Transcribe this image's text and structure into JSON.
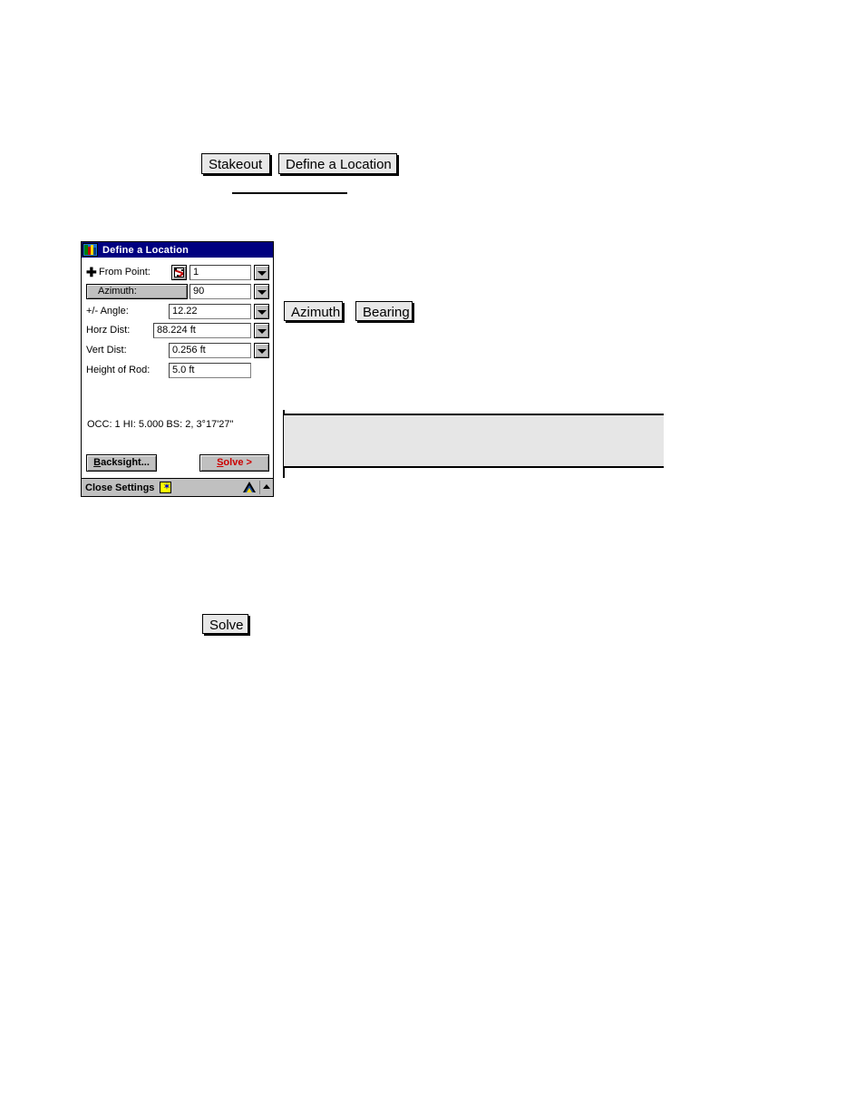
{
  "doc": {
    "buttons": {
      "stakeout": "Stakeout",
      "define_a_location": "Define a Location",
      "azimuth": "Azimuth",
      "bearing": "Bearing",
      "solve": "Solve"
    }
  },
  "pda": {
    "title": "Define a Location",
    "title_icon": "map-icon",
    "fields": [
      {
        "label": "From Point:",
        "icon": "plus-icon",
        "pick_icon": "point-pick-icon",
        "value": "1",
        "has_dropdown": true
      },
      {
        "label": "Azimuth:",
        "is_button": true,
        "value": "90",
        "has_dropdown": true
      },
      {
        "label": "+/- Angle:",
        "value": "12.22",
        "has_dropdown": true
      },
      {
        "label": "Horz Dist:",
        "value": "88.224 ft",
        "has_dropdown": true
      },
      {
        "label": "Vert Dist:",
        "value": "0.256 ft",
        "has_dropdown": true
      },
      {
        "label": "Height of Rod:",
        "value": "5.0 ft",
        "has_dropdown": false
      }
    ],
    "status_line": "OCC: 1  HI: 5.000  BS: 2, 3°17'27\"",
    "backsight_button": "Backsight...",
    "solve_button": "Solve >",
    "statusbar": {
      "close_settings": "Close Settings",
      "star_icon": "star-icon",
      "star_glyph": "✶",
      "instrument_icon": "tripod-icon",
      "scroll_icon": "scroll-up-icon"
    },
    "colors": {
      "titlebar": "#000080",
      "titlebar_text": "#ffffff",
      "solve_text": "#cc0000",
      "chrome": "#c0c0c0",
      "star_bg": "#ffff00"
    }
  }
}
